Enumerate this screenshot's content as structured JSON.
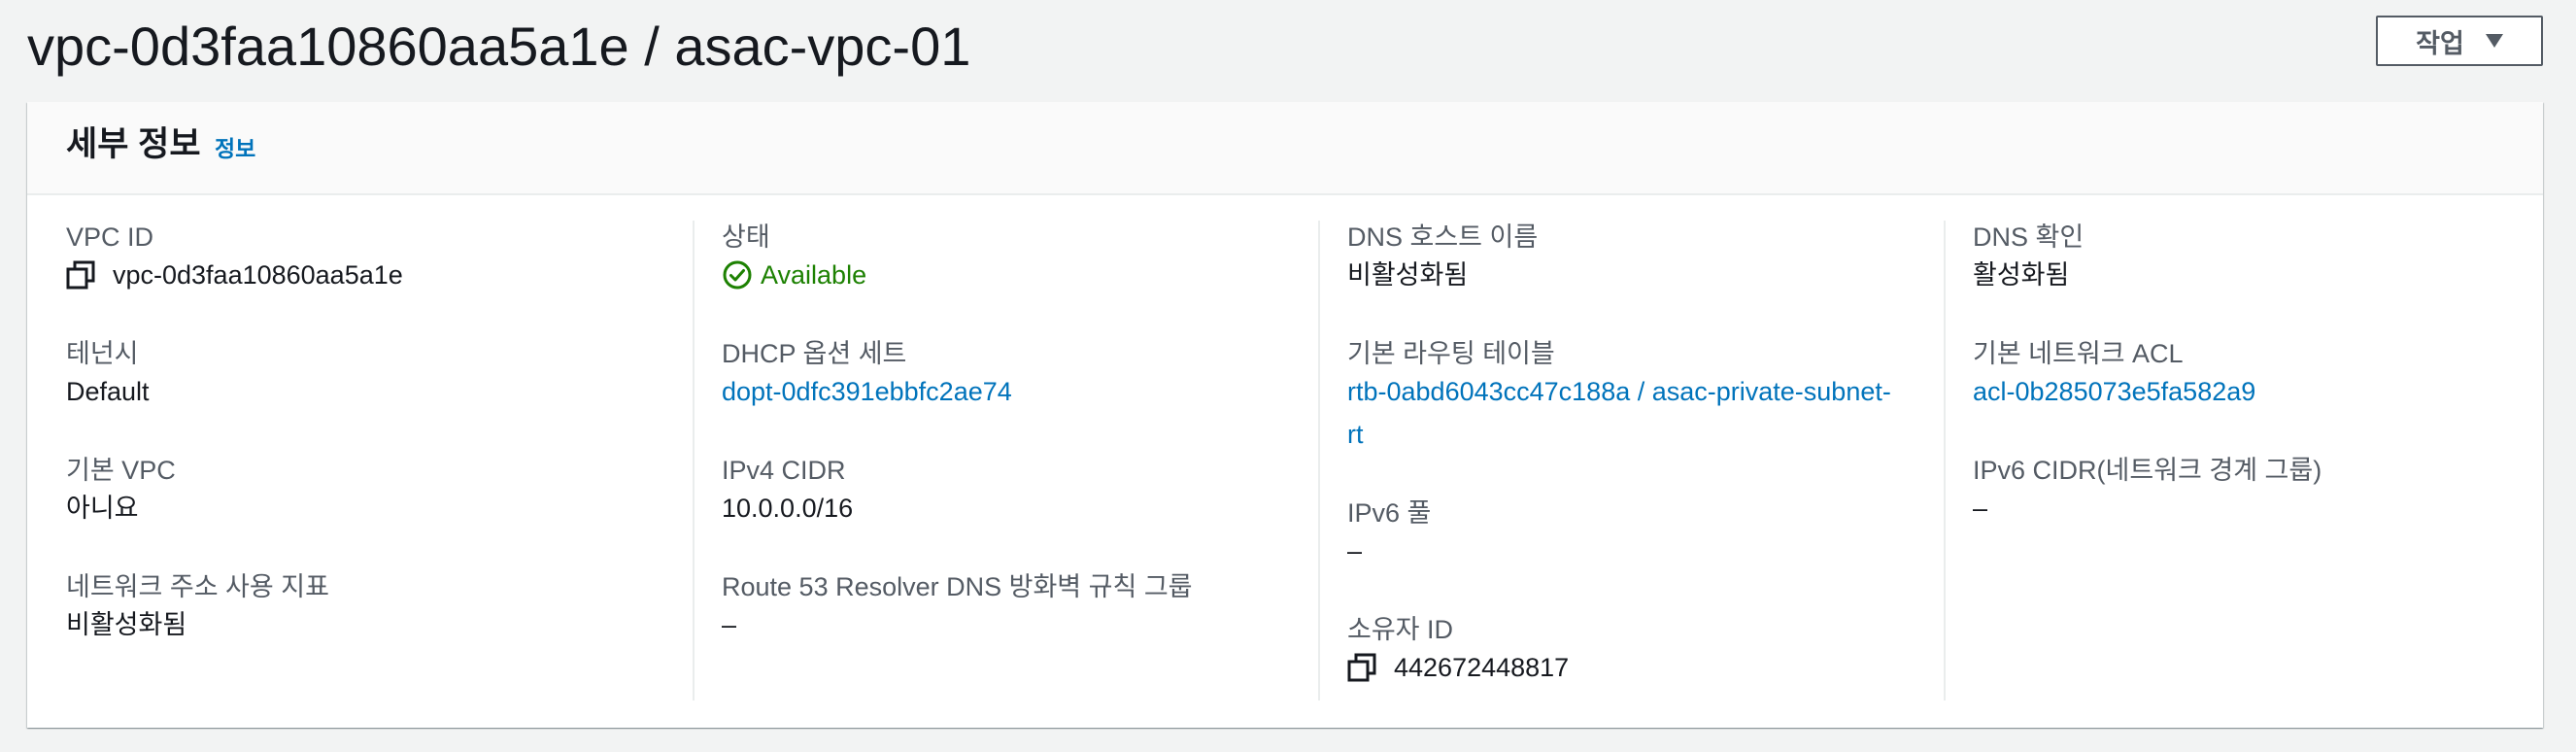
{
  "header": {
    "title": "vpc-0d3faa10860aa5a1e / asac-vpc-01",
    "actions_label": "작업"
  },
  "card": {
    "title": "세부 정보",
    "info_link": "정보"
  },
  "columns": [
    {
      "fields": [
        {
          "label": "VPC ID",
          "value": "vpc-0d3faa10860aa5a1e"
        },
        {
          "label": "테넌시",
          "value": "Default"
        },
        {
          "label": "기본 VPC",
          "value": "아니요"
        },
        {
          "label": "네트워크 주소 사용 지표",
          "value": "비활성화됨"
        }
      ]
    },
    {
      "fields": [
        {
          "label": "상태",
          "value": "Available"
        },
        {
          "label": "DHCP 옵션 세트",
          "value": "dopt-0dfc391ebbfc2ae74"
        },
        {
          "label": "IPv4 CIDR",
          "value": "10.0.0.0/16"
        },
        {
          "label": "Route 53 Resolver DNS 방화벽 규칙 그룹",
          "value": "–"
        }
      ]
    },
    {
      "fields": [
        {
          "label": "DNS 호스트 이름",
          "value": "비활성화됨"
        },
        {
          "label": "기본 라우팅 테이블",
          "value": "rtb-0abd6043cc47c188a / asac-private-subnet-rt"
        },
        {
          "label": "IPv6 풀",
          "value": "–"
        },
        {
          "label": "소유자 ID",
          "value": "442672448817"
        }
      ]
    },
    {
      "fields": [
        {
          "label": "DNS 확인",
          "value": "활성화됨"
        },
        {
          "label": "기본 네트워크 ACL",
          "value": "acl-0b285073e5fa582a9"
        },
        {
          "label": "IPv6 CIDR(네트워크 경계 그룹)",
          "value": "–"
        }
      ]
    }
  ],
  "colors": {
    "link": "#0073bb",
    "success": "#1d8102",
    "label": "#545b64",
    "text": "#16191f",
    "background": "#f2f3f3"
  },
  "icons": {
    "copy": "copy-icon",
    "status": "status-positive-icon",
    "caret": "caret-down-icon"
  }
}
